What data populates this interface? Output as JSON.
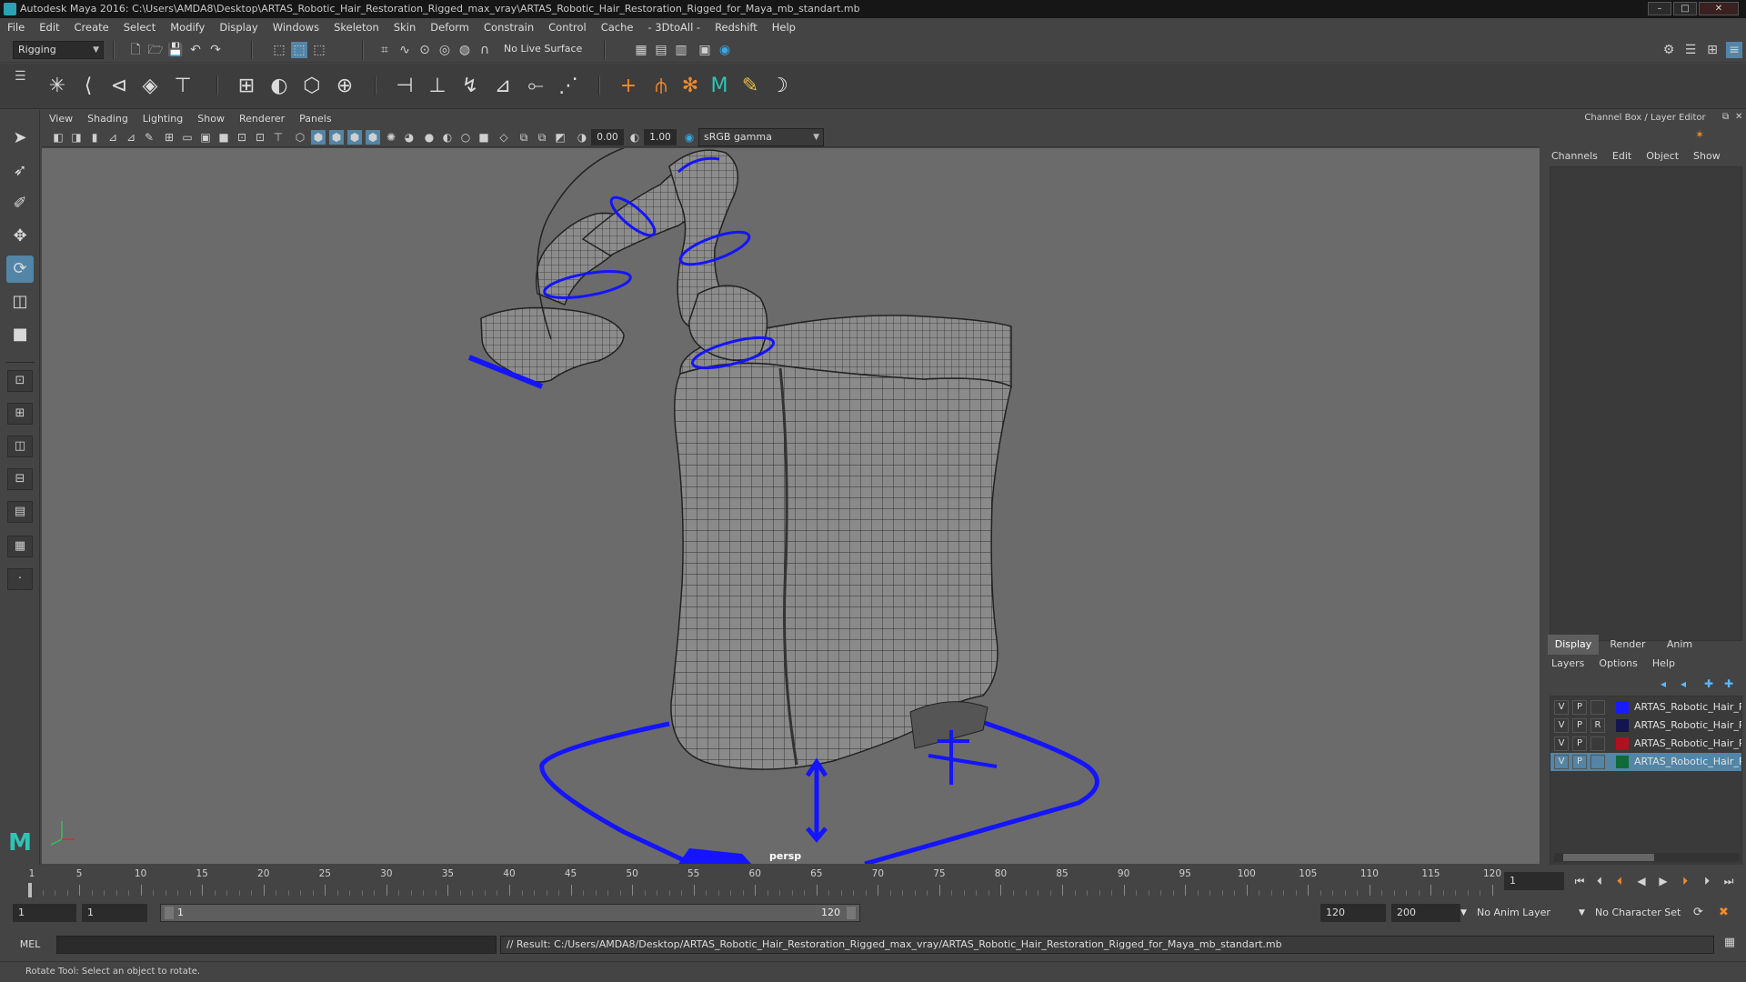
{
  "title_bar": {
    "text": "Autodesk Maya 2016: C:\\Users\\AMDA8\\Desktop\\ARTAS_Robotic_Hair_Restoration_Rigged_max_vray\\ARTAS_Robotic_Hair_Restoration_Rigged_for_Maya_mb_standart.mb",
    "minimize": "–",
    "maximize": "□",
    "close": "✕"
  },
  "menu_bar": [
    "File",
    "Edit",
    "Create",
    "Select",
    "Modify",
    "Display",
    "Windows",
    "Skeleton",
    "Skin",
    "Deform",
    "Constrain",
    "Control",
    "Cache",
    "- 3DtoAll -",
    "Redshift",
    "Help"
  ],
  "status_line": {
    "menu_set": "Rigging",
    "live_surface": "No Live Surface"
  },
  "shelf_icons": [
    "joint-icon",
    "ik-handle-icon",
    "ik-spline-icon",
    "insert-joint-icon",
    "mirror-joint-icon",
    "bind-skin-icon",
    "paint-weights-icon",
    "lattice-icon",
    "cluster-icon",
    "locator-icon",
    "point-constraint-icon",
    "aim-constraint-icon",
    "orient-constraint-icon",
    "scale-constraint-icon",
    "parent-constraint-icon",
    "pole-vector-icon",
    "plus-icon",
    "twist-icon",
    "hik-icon",
    "character-icon",
    "paint-icon"
  ],
  "viewport": {
    "menu": [
      "View",
      "Shading",
      "Lighting",
      "Show",
      "Renderer",
      "Panels"
    ],
    "exposure": "0.00",
    "gamma": "1.00",
    "color_space": "sRGB gamma",
    "camera_label": "persp"
  },
  "channel_box": {
    "title": "Channel Box / Layer Editor",
    "menu": [
      "Channels",
      "Edit",
      "Object",
      "Show"
    ]
  },
  "layer_editor": {
    "tabs": [
      "Display",
      "Render",
      "Anim"
    ],
    "active_tab": "Display",
    "menu": [
      "Layers",
      "Options",
      "Help"
    ],
    "layers": [
      {
        "v": "V",
        "p": "P",
        "r": "",
        "color": "#1a1aff",
        "name": "ARTAS_Robotic_Hair_R",
        "selected": false
      },
      {
        "v": "V",
        "p": "P",
        "r": "R",
        "color": "#141450",
        "name": "ARTAS_Robotic_Hair_R",
        "selected": false
      },
      {
        "v": "V",
        "p": "P",
        "r": "",
        "color": "#b01020",
        "name": "ARTAS_Robotic_Hair_R",
        "selected": false
      },
      {
        "v": "V",
        "p": "P",
        "r": "",
        "color": "#0f6a3a",
        "name": "ARTAS_Robotic_Hair_R",
        "selected": true
      }
    ]
  },
  "time_slider": {
    "ticks": [
      1,
      5,
      10,
      15,
      20,
      25,
      30,
      35,
      40,
      45,
      50,
      55,
      60,
      65,
      70,
      75,
      80,
      85,
      90,
      95,
      100,
      105,
      110,
      115,
      120
    ],
    "current_frame": "1",
    "cursor_frame": "1"
  },
  "range_slider": {
    "start_frame": "1",
    "playback_start": "1",
    "bar_start": "1",
    "bar_end": "120",
    "playback_end": "120",
    "end_frame": "200",
    "anim_layer": "No Anim Layer",
    "character_set": "No Character Set"
  },
  "command_line": {
    "label": "MEL",
    "result": "// Result: C:/Users/AMDA8/Desktop/ARTAS_Robotic_Hair_Restoration_Rigged_max_vray/ARTAS_Robotic_Hair_Restoration_Rigged_for_Maya_mb_standart.mb"
  },
  "help_line": "Rotate Tool: Select an object to rotate.",
  "colors": {
    "accent": "#5285a6",
    "viewport_bg": "#6b6b6b",
    "rig_control": "#1a1aff"
  }
}
